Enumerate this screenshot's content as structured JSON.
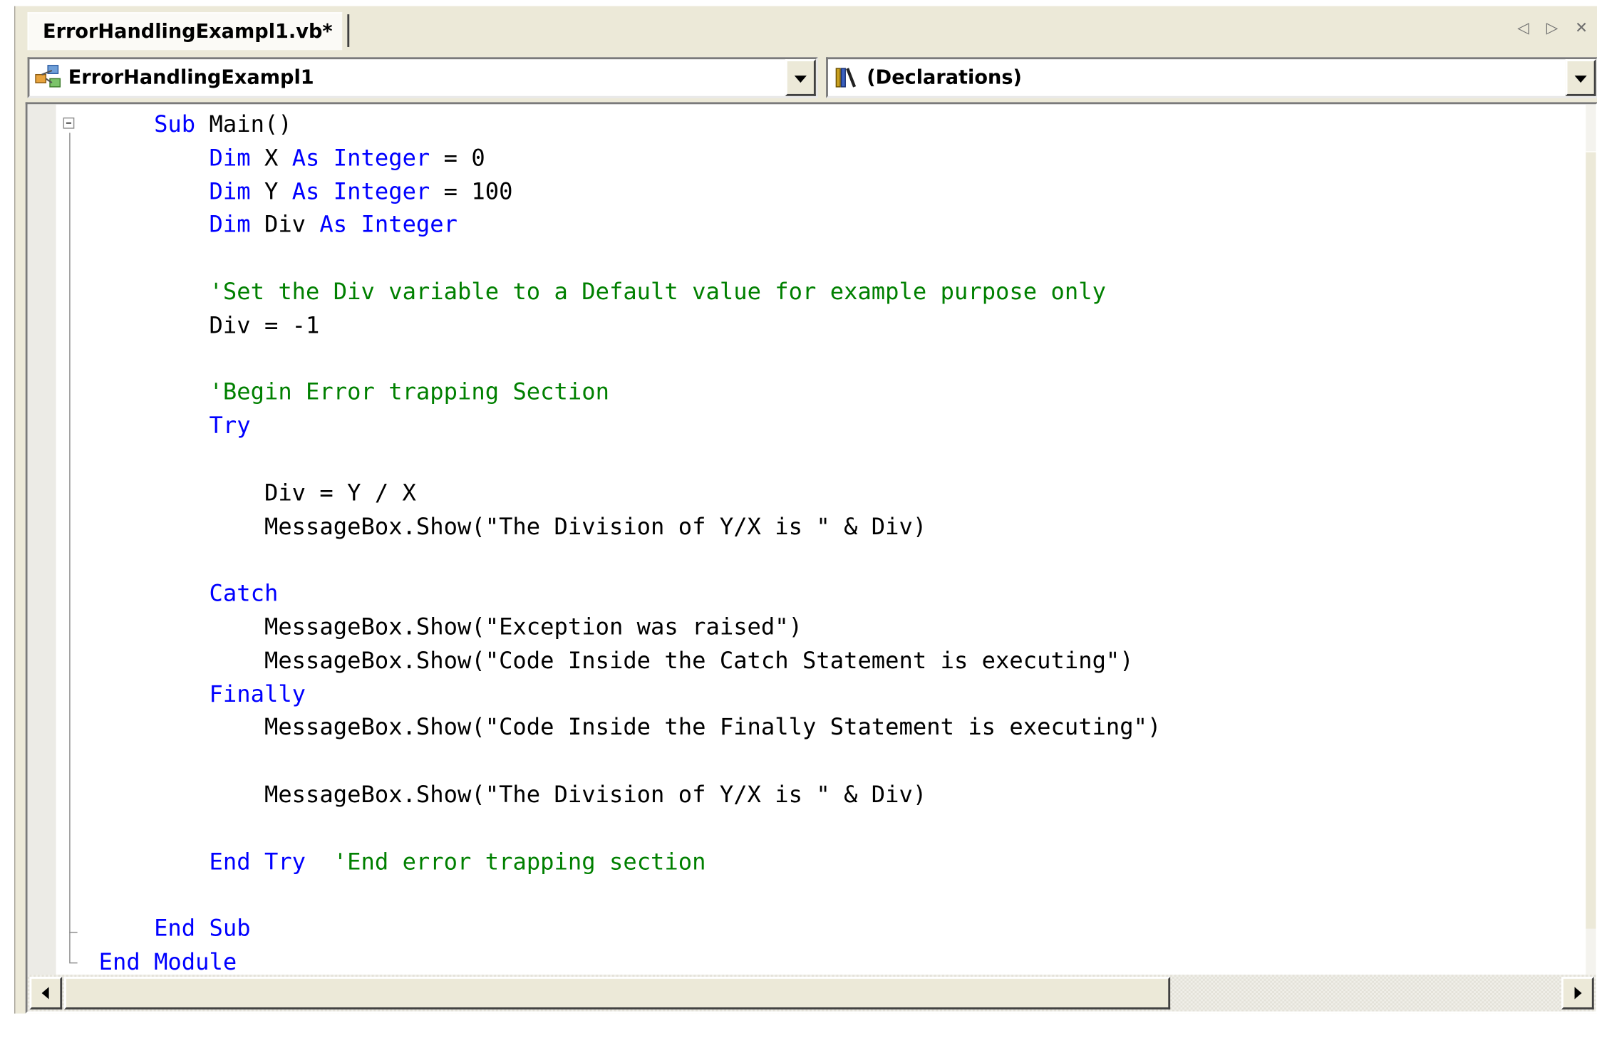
{
  "tab": {
    "title": "ErrorHandlingExampl1.vb*",
    "nav_glyphs": "◁ ▷ ✕"
  },
  "class_combo": {
    "value": "ErrorHandlingExampl1",
    "icon": "module-icon"
  },
  "method_combo": {
    "value": "(Declarations)",
    "icon": "declarations-icon"
  },
  "colors": {
    "keyword": "#0000ff",
    "comment": "#008000",
    "text": "#000000"
  },
  "code": {
    "lines": [
      [
        [
          "    ",
          ""
        ],
        [
          "Sub",
          "kw"
        ],
        [
          " Main()",
          ""
        ]
      ],
      [
        [
          "        ",
          ""
        ],
        [
          "Dim",
          "kw"
        ],
        [
          " X ",
          ""
        ],
        [
          "As",
          "kw"
        ],
        [
          " ",
          ""
        ],
        [
          "Integer",
          "kw"
        ],
        [
          " = 0",
          ""
        ]
      ],
      [
        [
          "        ",
          ""
        ],
        [
          "Dim",
          "kw"
        ],
        [
          " Y ",
          ""
        ],
        [
          "As",
          "kw"
        ],
        [
          " ",
          ""
        ],
        [
          "Integer",
          "kw"
        ],
        [
          " = 100",
          ""
        ]
      ],
      [
        [
          "        ",
          ""
        ],
        [
          "Dim",
          "kw"
        ],
        [
          " Div ",
          ""
        ],
        [
          "As",
          "kw"
        ],
        [
          " ",
          ""
        ],
        [
          "Integer",
          "kw"
        ]
      ],
      [],
      [
        [
          "        ",
          ""
        ],
        [
          "'Set the Div variable to a Default value for example purpose only",
          "cm"
        ]
      ],
      [
        [
          "        Div = -1",
          ""
        ]
      ],
      [],
      [
        [
          "        ",
          ""
        ],
        [
          "'Begin Error trapping Section",
          "cm"
        ]
      ],
      [
        [
          "        ",
          ""
        ],
        [
          "Try",
          "kw"
        ]
      ],
      [],
      [
        [
          "            Div = Y / X",
          ""
        ]
      ],
      [
        [
          "            MessageBox.Show(\"The Division of Y/X is \" & Div)",
          ""
        ]
      ],
      [],
      [
        [
          "        ",
          ""
        ],
        [
          "Catch",
          "kw"
        ]
      ],
      [
        [
          "            MessageBox.Show(\"Exception was raised\")",
          ""
        ]
      ],
      [
        [
          "            MessageBox.Show(\"Code Inside the Catch Statement is executing\")",
          ""
        ]
      ],
      [
        [
          "        ",
          ""
        ],
        [
          "Finally",
          "kw"
        ]
      ],
      [
        [
          "            MessageBox.Show(\"Code Inside the Finally Statement is executing\")",
          ""
        ]
      ],
      [],
      [
        [
          "            MessageBox.Show(\"The Division of Y/X is \" & Div)",
          ""
        ]
      ],
      [],
      [
        [
          "        ",
          ""
        ],
        [
          "End",
          "kw"
        ],
        [
          " ",
          ""
        ],
        [
          "Try",
          "kw"
        ],
        [
          "  ",
          ""
        ],
        [
          "'End error trapping section",
          "cm"
        ]
      ],
      [],
      [
        [
          "    ",
          ""
        ],
        [
          "End",
          "kw"
        ],
        [
          " ",
          ""
        ],
        [
          "Sub",
          "kw"
        ]
      ],
      [
        [
          "",
          ""
        ],
        [
          "End",
          "kw"
        ],
        [
          " ",
          ""
        ],
        [
          "Module",
          "kw"
        ]
      ]
    ]
  }
}
